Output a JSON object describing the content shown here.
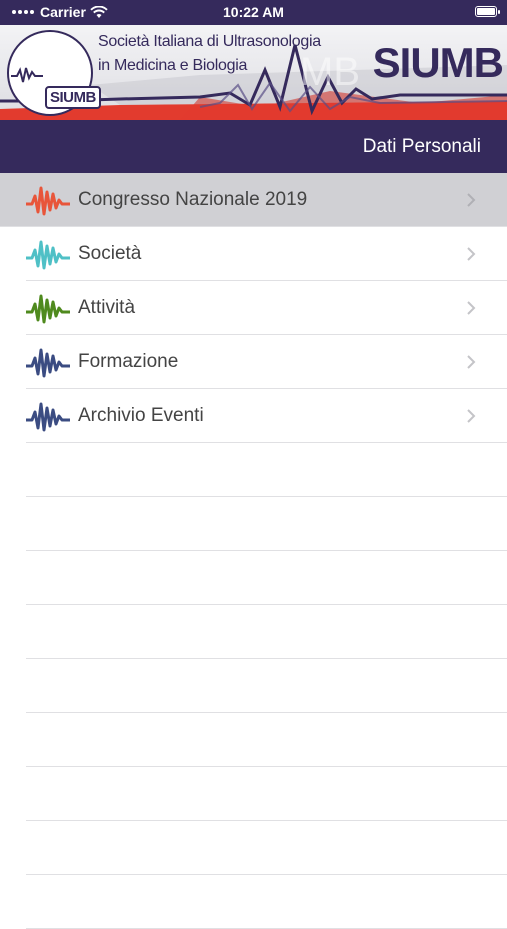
{
  "status_bar": {
    "carrier": "Carrier",
    "time": "10:22 AM"
  },
  "banner": {
    "logo_text": "SIUMB",
    "line1": "Società Italiana di Ultrasonologia",
    "line2": "in Medicina e Biologia",
    "brand": "SIUMB"
  },
  "nav": {
    "right_label": "Dati Personali"
  },
  "menu": {
    "items": [
      {
        "label": "Congresso Nazionale 2019",
        "icon": "wave-icon",
        "color": "#e8553a",
        "selected": true
      },
      {
        "label": "Società",
        "icon": "wave-icon",
        "color": "#4fc0c6",
        "selected": false
      },
      {
        "label": "Attività",
        "icon": "wave-icon",
        "color": "#4f8a1e",
        "selected": false
      },
      {
        "label": "Formazione",
        "icon": "wave-icon",
        "color": "#3b4c82",
        "selected": false
      },
      {
        "label": "Archivio Eventi",
        "icon": "wave-icon",
        "color": "#3b4c82",
        "selected": false
      }
    ]
  },
  "colors": {
    "primary": "#352a5c",
    "accent_red": "#e23b2e",
    "selected_row": "#d0d0d4"
  }
}
